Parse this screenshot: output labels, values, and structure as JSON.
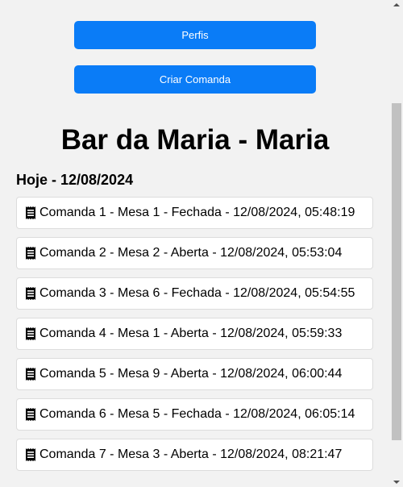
{
  "buttons": {
    "perfis_label": "Perfis",
    "criar_comanda_label": "Criar Comanda"
  },
  "header": {
    "title": "Bar da Maria - Maria",
    "date_heading": "Hoje - 12/08/2024"
  },
  "comandas": [
    {
      "label": "Comanda 1 - Mesa 1 - Fechada - 12/08/2024, 05:48:19",
      "icon": "receipt-icon"
    },
    {
      "label": "Comanda 2 - Mesa 2 - Aberta - 12/08/2024, 05:53:04",
      "icon": "receipt-icon"
    },
    {
      "label": "Comanda 3 - Mesa 6 - Fechada - 12/08/2024, 05:54:55",
      "icon": "receipt-icon"
    },
    {
      "label": "Comanda 4 - Mesa 1 - Aberta - 12/08/2024, 05:59:33",
      "icon": "receipt-icon"
    },
    {
      "label": "Comanda 5 - Mesa 9 - Aberta - 12/08/2024, 06:00:44",
      "icon": "receipt-icon"
    },
    {
      "label": "Comanda 6 - Mesa 5 - Fechada - 12/08/2024, 06:05:14",
      "icon": "receipt-icon"
    },
    {
      "label": "Comanda 7 - Mesa 3 - Aberta - 12/08/2024, 08:21:47",
      "icon": "receipt-icon"
    }
  ],
  "colors": {
    "primary_button": "#0a7cf7",
    "background": "#f2f2f2",
    "card": "#ffffff"
  }
}
